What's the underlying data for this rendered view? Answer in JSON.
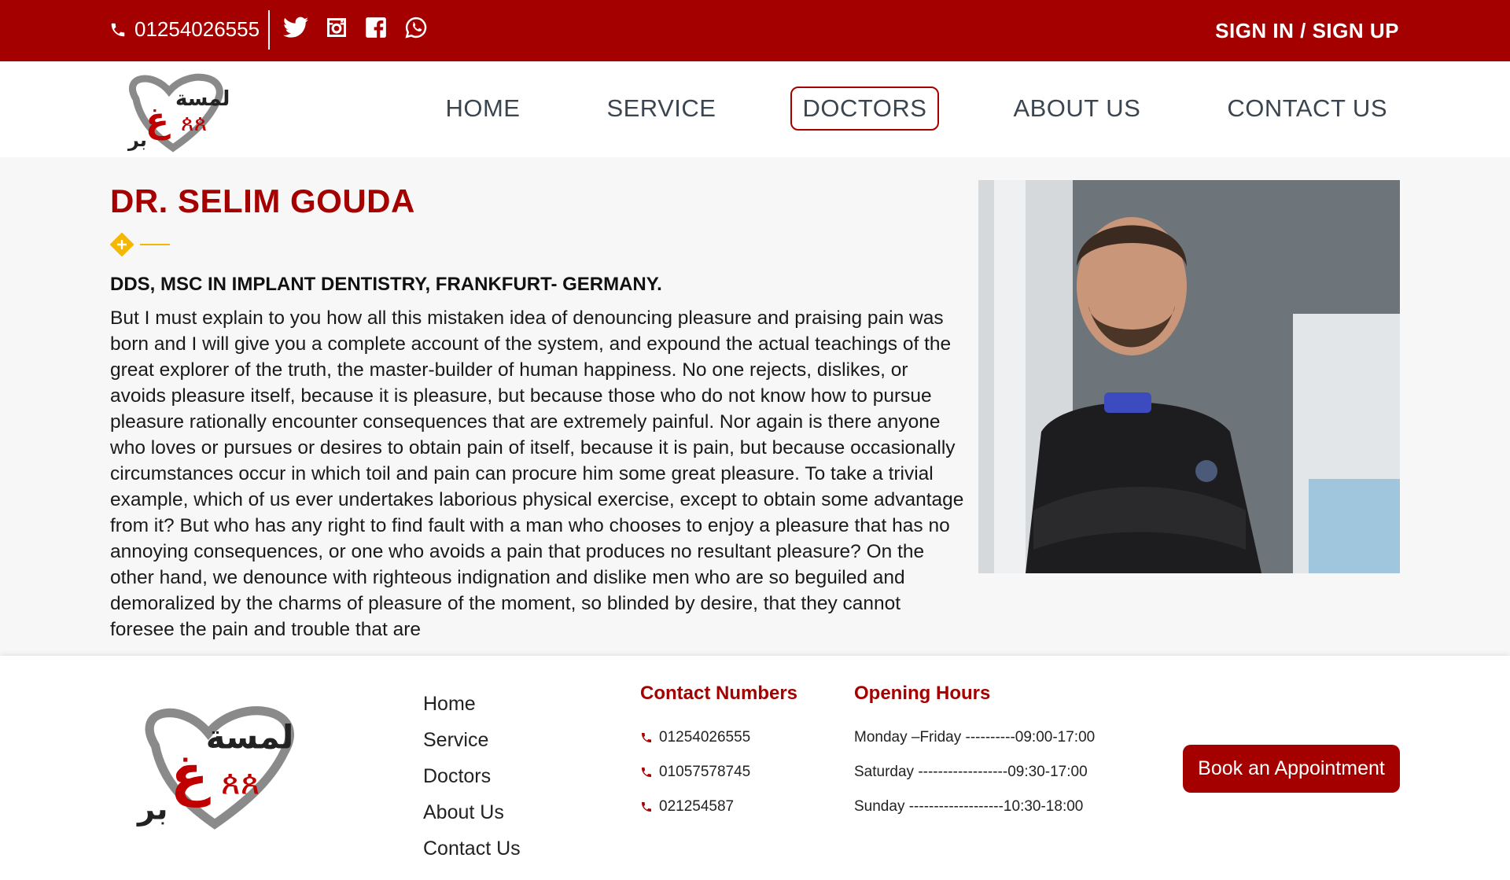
{
  "topbar": {
    "phone": "01254026555",
    "phone_icon": "phone-icon",
    "social_icons": [
      "twitter-icon",
      "instagram-icon",
      "facebook-icon",
      "whatsapp-icon"
    ],
    "signin_label": "SIGN IN / SIGN UP"
  },
  "header": {
    "logo_icon": "heart-runners-logo",
    "logo_text": "لمسة عبير",
    "nav": [
      {
        "label": "HOME"
      },
      {
        "label": "SERVICE"
      },
      {
        "label": "DOCTORS",
        "active": true
      },
      {
        "label": "ABOUT US"
      },
      {
        "label": "CONTACT US"
      }
    ]
  },
  "doctor": {
    "name": "DR. SELIM GOUDA",
    "subtitle": "DDS, MSC IN IMPLANT DENTISTRY, FRANKFURT- GERMANY.",
    "bio": "But I must explain to you how all this mistaken idea of denouncing pleasure and praising pain was born and I will give you a complete account of the system, and expound the actual teachings of the great explorer of the truth, the master-builder of human happiness. No one rejects, dislikes, or avoids pleasure itself, because it is pleasure, but because those who do not know how to pursue pleasure rationally encounter consequences that are extremely painful. Nor again is there anyone who loves or pursues or desires to obtain pain of itself, because it is pain, but because occasionally circumstances occur in which toil and pain can procure him some great pleasure. To take a trivial example, which of us ever undertakes laborious physical exercise, except to obtain some advantage from it? But who has any right to find fault with a man who chooses to enjoy a pleasure that has no annoying consequences, or one who avoids a pain that produces no resultant pleasure? On the other hand, we denounce with righteous indignation and dislike men who are so beguiled and demoralized by the charms of pleasure of the moment, so blinded by desire, that they cannot foresee the pain and trouble that are",
    "photo": "doctor-portrait-photo"
  },
  "footer": {
    "links": [
      "Home",
      "Service",
      "Doctors",
      "About Us",
      "Contact Us"
    ],
    "contact_title": "Contact Numbers",
    "numbers": [
      "01254026555",
      "01057578745",
      "021254587"
    ],
    "hours_title": "Opening Hours",
    "hours": [
      "Monday –Friday ----------09:00-17:00",
      "Saturday ------------------09:30-17:00",
      "Sunday -------------------10:30-18:00"
    ],
    "book_label": "Book an Appointment"
  },
  "colors": {
    "brand": "#a50000",
    "accent_gold": "#f5b800",
    "nav_text": "#3b4550"
  }
}
